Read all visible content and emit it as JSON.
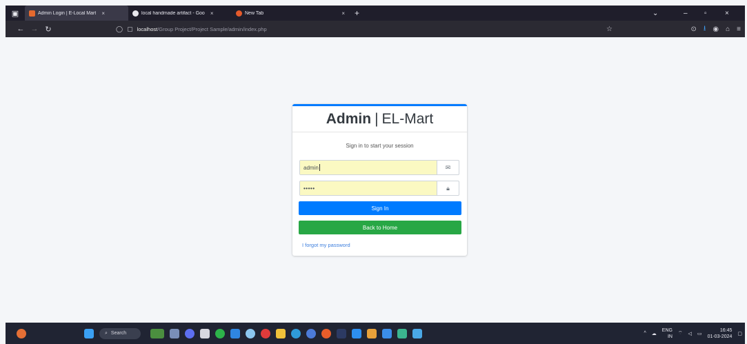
{
  "browser": {
    "tabs": [
      {
        "title": "Admin Login | E-Local Mart",
        "favicon_color": "#e5692e",
        "active": true
      },
      {
        "title": "local handmade artifact - Goo",
        "favicon_color": "#e8e8ee",
        "active": false
      },
      {
        "title": "New Tab",
        "favicon_color": "#e55a2b",
        "active": false
      }
    ],
    "tab_close_glyph": "×",
    "new_tab_glyph": "+",
    "url_host": "localhost",
    "url_path": "/Group Project/Project Sample/admin/index.php",
    "window_controls": [
      "⌄",
      "–",
      "▫",
      "×"
    ]
  },
  "login": {
    "brand_bold": "Admin",
    "brand_sep": "|",
    "brand_rest": "EL-Mart",
    "message": "Sign in to start your session",
    "username_value": "admin",
    "password_value": "•••••",
    "sign_in_label": "Sign In",
    "back_home_label": "Back to Home",
    "forgot_label": "I forgot my password",
    "accent_color": "#007bff",
    "success_color": "#28a745"
  },
  "taskbar": {
    "search_label": "Search",
    "lang_line1": "ENG",
    "lang_line2": "IN",
    "time": "16:45",
    "date": "01-03-2024"
  }
}
